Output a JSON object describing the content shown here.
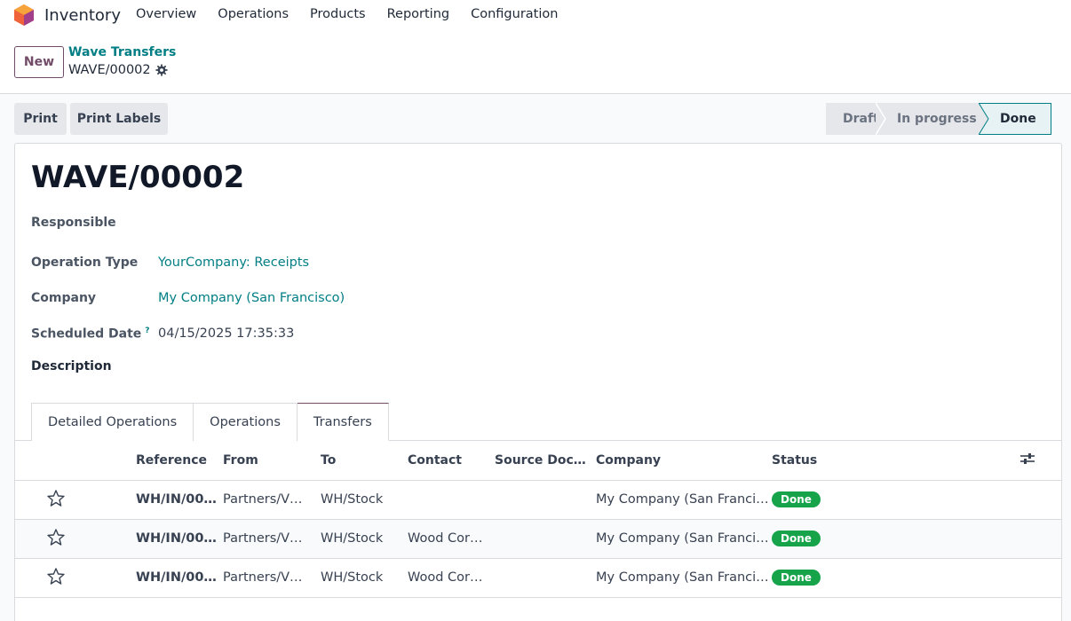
{
  "app": {
    "title": "Inventory"
  },
  "menu": [
    "Overview",
    "Operations",
    "Products",
    "Reporting",
    "Configuration"
  ],
  "control_panel": {
    "new_label": "New",
    "breadcrumb_parent": "Wave Transfers",
    "breadcrumb_current": "WAVE/00002"
  },
  "actions": {
    "print": "Print",
    "print_labels": "Print Labels"
  },
  "statusbar": {
    "stages": [
      "Draft",
      "In progress",
      "Done"
    ],
    "active": "Done"
  },
  "record": {
    "title": "WAVE/00002",
    "responsible_label": "Responsible",
    "operation_type_label": "Operation Type",
    "operation_type_value": "YourCompany: Receipts",
    "company_label": "Company",
    "company_value": "My Company (San Francisco)",
    "scheduled_date_label": "Scheduled Date",
    "scheduled_date_help": "?",
    "scheduled_date_value": "04/15/2025 17:35:33",
    "description_label": "Description"
  },
  "tabs": [
    "Detailed Operations",
    "Operations",
    "Transfers"
  ],
  "active_tab": "Transfers",
  "table": {
    "columns": [
      "Reference",
      "From",
      "To",
      "Contact",
      "Source Doc…",
      "Company",
      "Status"
    ],
    "rows": [
      {
        "reference": "WH/IN/00…",
        "from": "Partners/V…",
        "to": "WH/Stock",
        "contact": "",
        "source": "",
        "company": "My Company (San Franci…",
        "status": "Done"
      },
      {
        "reference": "WH/IN/00…",
        "from": "Partners/V…",
        "to": "WH/Stock",
        "contact": "Wood Cor…",
        "source": "",
        "company": "My Company (San Franci…",
        "status": "Done"
      },
      {
        "reference": "WH/IN/00…",
        "from": "Partners/V…",
        "to": "WH/Stock",
        "contact": "Wood Cor…",
        "source": "",
        "company": "My Company (San Franci…",
        "status": "Done"
      }
    ]
  },
  "colors": {
    "brand": "#714b67",
    "link": "#017e84",
    "done_badge": "#16a34a"
  }
}
